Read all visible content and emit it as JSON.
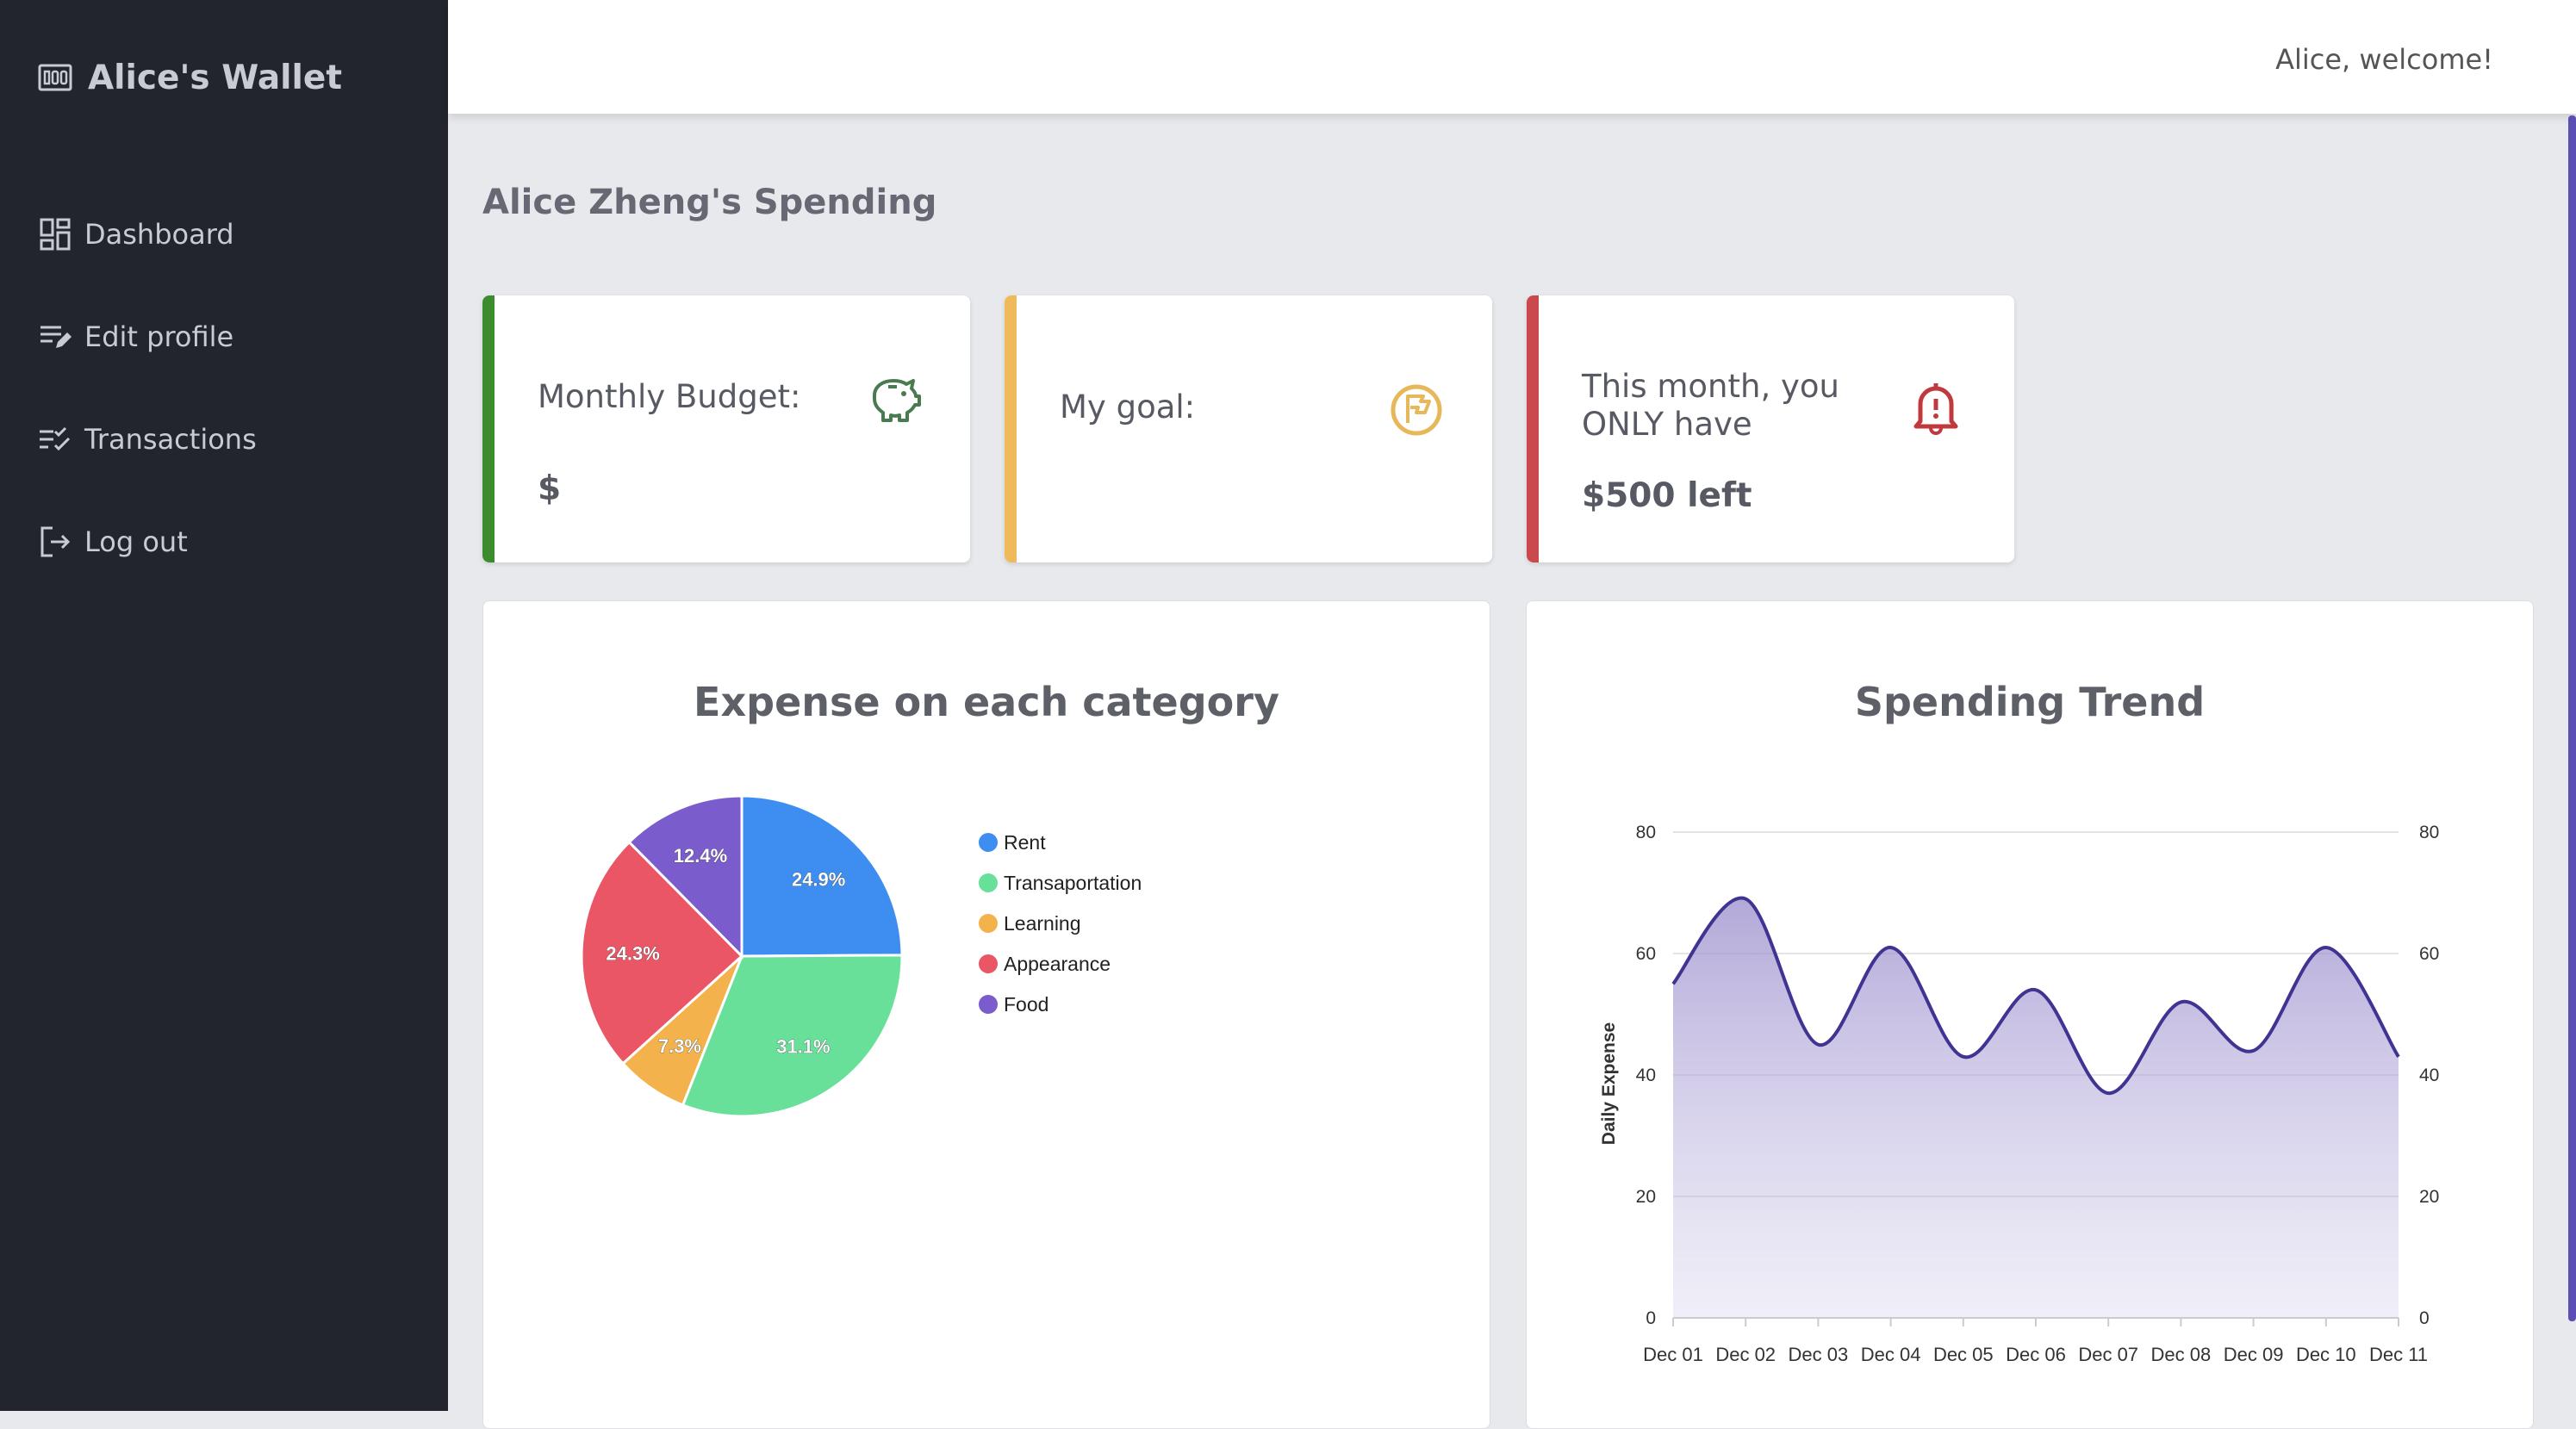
{
  "sidebar": {
    "brand_icon": "wallet-icon",
    "brand": "Alice's Wallet",
    "items": [
      {
        "label": "Dashboard",
        "icon": "dashboard-icon"
      },
      {
        "label": "Edit profile",
        "icon": "edit-profile-icon"
      },
      {
        "label": "Transactions",
        "icon": "transactions-icon"
      },
      {
        "label": "Log out",
        "icon": "logout-icon"
      }
    ]
  },
  "topbar": {
    "welcome": "Alice, welcome!"
  },
  "page": {
    "title": "Alice Zheng's Spending"
  },
  "cards": [
    {
      "label": "Monthly Budget:",
      "value": "$",
      "icon": "piggy-bank-icon",
      "accent": "#3d8b2f",
      "icon_color": "#4a7a50"
    },
    {
      "label": "My goal:",
      "value": "",
      "icon": "flag-icon",
      "accent": "#efbb5a",
      "icon_color": "#e6b85a"
    },
    {
      "label": "This month, you ONLY have",
      "value": "$500 left",
      "icon": "bell-alert-icon",
      "accent": "#c9494d",
      "icon_color": "#c0393e"
    }
  ],
  "panels": {
    "pie_title": "Expense on each category",
    "trend_title": "Spending Trend"
  },
  "chart_data": [
    {
      "type": "pie",
      "title": "Expense on each category",
      "categories": [
        "Rent",
        "Transaportation",
        "Learning",
        "Appearance",
        "Food"
      ],
      "values": [
        24.9,
        31.1,
        7.3,
        24.3,
        12.4
      ],
      "labels": [
        "24.9%",
        "31.1%",
        "7.3%",
        "24.3%",
        "12.4%"
      ],
      "colors": [
        "#3d8ef0",
        "#68e09a",
        "#f3b24b",
        "#ea5665",
        "#7a5ccc"
      ],
      "legend": "right"
    },
    {
      "type": "area",
      "title": "Spending Trend",
      "ylabel": "Daily Expense",
      "x": [
        "Dec 01",
        "Dec 02",
        "Dec 03",
        "Dec 04",
        "Dec 05",
        "Dec 06",
        "Dec 07",
        "Dec 08",
        "Dec 09",
        "Dec 10",
        "Dec 11"
      ],
      "values": [
        55,
        69,
        45,
        61,
        43,
        54,
        37,
        52,
        44,
        61,
        43
      ],
      "ylim": [
        0,
        80
      ],
      "yticks": [
        "0",
        "20",
        "40",
        "60",
        "80"
      ],
      "grid": true,
      "color": "#3f3491"
    }
  ]
}
